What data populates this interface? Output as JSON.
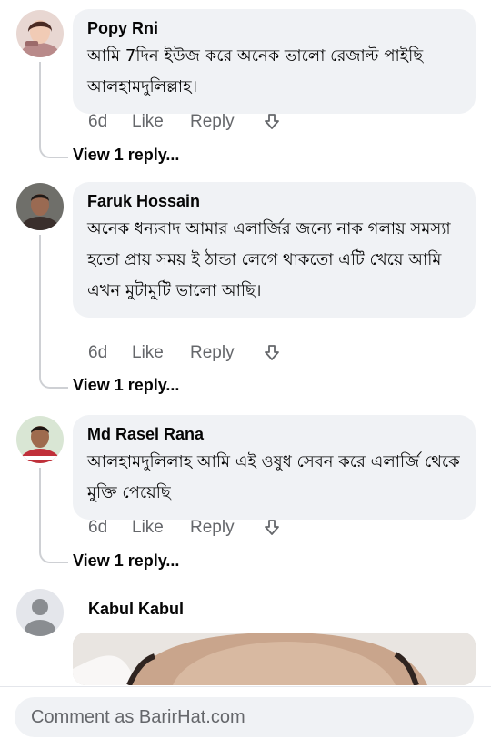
{
  "comments": [
    {
      "author": "Popy Rni",
      "text": "আমি 7দিন ইউজ করে অনেক ভালো রেজাল্ট পাইছি আলহামদুলিল্লাহ।",
      "age": "6d",
      "like_label": "Like",
      "reply_label": "Reply",
      "view_replies_label": "View 1 reply..."
    },
    {
      "author": "Faruk Hossain",
      "text": "অনেক ধন্যবাদ আমার এলার্জির জন্যে নাক গলায় সমস্যা হতো প্রায় সময় ই ঠান্ডা লেগে থাকতো এটি খেয়ে আমি এখন মুটামুটি ভালো আছি।",
      "age": "6d",
      "like_label": "Like",
      "reply_label": "Reply",
      "view_replies_label": "View 1 reply..."
    },
    {
      "author": "Md Rasel Rana",
      "text": "আলহামদুলিলাহ আমি এই ওষুধ সেবন করে এলার্জি থেকে মুক্তি পেয়েছি",
      "age": "6d",
      "like_label": "Like",
      "reply_label": "Reply",
      "view_replies_label": "View 1 reply..."
    },
    {
      "author": "Kabul Kabul"
    }
  ],
  "composer": {
    "placeholder": "Comment as BarirHat.com"
  },
  "colors": {
    "bubble": "#f0f2f5",
    "secondary_text": "#65676b",
    "thread_line": "#ced0d4"
  }
}
